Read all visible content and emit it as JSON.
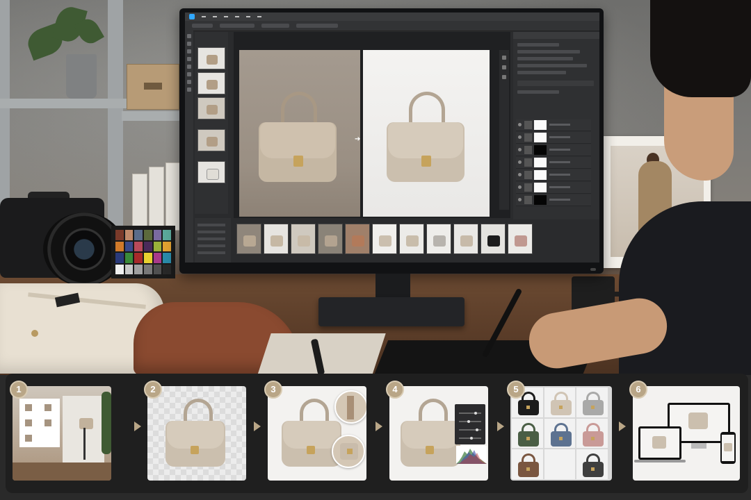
{
  "workflow": {
    "steps": [
      {
        "number": "1"
      },
      {
        "number": "2"
      },
      {
        "number": "3"
      },
      {
        "number": "4"
      },
      {
        "number": "5"
      },
      {
        "number": "6"
      }
    ]
  },
  "colors": {
    "bag_taupe": "#cbbfae",
    "badge_gold": "#b9a687",
    "editor_bg": "#2a2b2d",
    "editor_accent": "#31a8ff",
    "clasp_gold": "#c6a35c"
  },
  "variant_bag_colors": [
    "#1c1c1c",
    "#d0c4b4",
    "#a9a9a8",
    "#4a5e45",
    "#5d7290",
    "#c99a97",
    "#7a5640",
    "#3f3f3f"
  ],
  "checker_colors": [
    "#7a3a2a",
    "#c08a6a",
    "#5a6c8a",
    "#5c6a3c",
    "#7a6aa0",
    "#5aa89a",
    "#d07a2a",
    "#3a4a8a",
    "#b84a5a",
    "#4a2a5a",
    "#9ab03a",
    "#e0a030",
    "#2a3a7a",
    "#3a8a3a",
    "#a82a2a",
    "#e8d030",
    "#a83a8a",
    "#2a8aa8",
    "#f0f0f0",
    "#c8c8c8",
    "#a0a0a0",
    "#787878",
    "#505050",
    "#282828"
  ],
  "icons": {
    "app": "image-editor-icon",
    "step_arrow": "triangle-right-icon"
  }
}
